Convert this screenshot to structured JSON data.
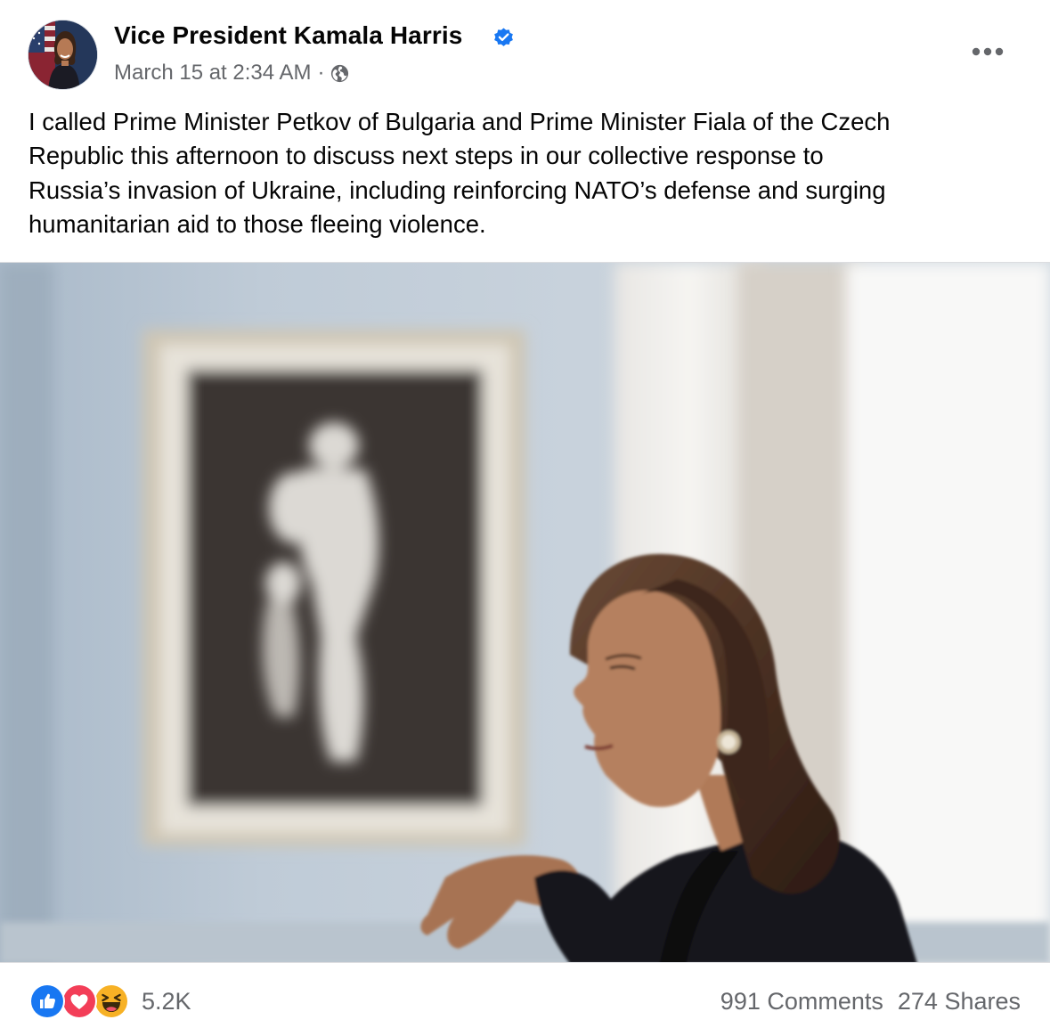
{
  "post": {
    "author": "Vice President Kamala Harris",
    "timestamp": "March 15 at 2:34 AM",
    "separator": "·",
    "verified": true,
    "text_lines": [
      "I called Prime Minister Petkov of Bulgaria and Prime Minister Fiala of the Czech",
      "Republic this afternoon to discuss next steps in our collective response to",
      "Russia’s invasion of Ukraine, including reinforcing NATO’s defense and surging",
      "humanitarian aid to those fleeing violence."
    ]
  },
  "footer": {
    "reaction_count": "5.2K",
    "comments": "991 Comments",
    "shares": "274 Shares"
  },
  "icons": {
    "verified": "verified-badge-icon",
    "audience": "globe-icon",
    "menu": "more-options-icon",
    "reactions": [
      "like-reaction-icon",
      "love-reaction-icon",
      "haha-reaction-icon"
    ]
  },
  "colors": {
    "brand_blue": "#1877f2",
    "love_red": "#f33e58",
    "haha_yellow": "#f7b125",
    "secondary_text": "#65676b",
    "primary_text": "#050505"
  }
}
